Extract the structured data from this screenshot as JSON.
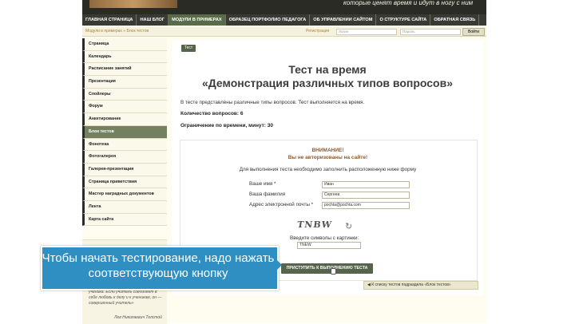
{
  "header": {
    "tagline": "которые ценят время и идут в ногу с ним"
  },
  "nav": {
    "items": [
      "ГЛАВНАЯ СТРАНИЦА",
      "НАШ БЛОГ",
      "МОДУЛИ В ПРИМЕРАХ",
      "ОБРАЗЕЦ ПОРТФОЛИО ПЕДАГОГА",
      "ОБ УПРАВЛЕНИИ САЙТОМ",
      "О СТРУКТУРЕ САЙТА",
      "ОБРАТНАЯ СВЯЗЬ"
    ],
    "active_index": 2
  },
  "subbar": {
    "breadcrumb": "Модули в примерах » Блок тестов",
    "register_link": "Регистрация",
    "login_placeholder": "Логин",
    "password_placeholder": "Пароль",
    "login_button": "Войти"
  },
  "sidebar": {
    "items": [
      "Страница",
      "Календарь",
      "Расписание занятий",
      "Презентация",
      "Спойлеры",
      "Форум",
      "Анкетирование",
      "Блок тестов",
      "Фонотека",
      "Фотогалерея",
      "Галерея-презентация",
      "Страница приветствия",
      "Мастер наградных документов",
      "Лента",
      "Карта сайта"
    ],
    "active_index": 7,
    "quote_text": "ученика. Если учитель соединяет в себе любовь к делу и к ученикам, он — совершенный учитель»",
    "quote_author": "Лев Николаевич Толстой"
  },
  "main": {
    "test_button": "Тест",
    "title_line1": "Тест на время",
    "title_line2": "«Демонстрация различных типов вопросов»",
    "description": "В тесте представлены различные типы вопросов. Тест выполняется на время.",
    "question_count": "Количество вопросов: 6",
    "time_limit": "Ограничение по времени, минут: 30",
    "warning_title": "ВНИМАНИЕ!",
    "warning_text": "Вы не авторизованы на сайте!",
    "instructions": "Для выполнения теста необходимо заполнить расположенную ниже форму",
    "form": {
      "name_label": "Ваше имя *",
      "name_value": "Иван",
      "surname_label": "Ваша фамилия",
      "surname_value": "Сергеев",
      "email_label": "Адрес электронной почты *",
      "email_value": "pochta@pochta.com",
      "captcha_image_text": "TNBW",
      "captcha_label": "Введите символы с картинки:",
      "captcha_value": "TNEW"
    },
    "start_button": "ПРИСТУПИТЬ К ВЫПОЛНЕНИЮ ТЕСТА",
    "back_link": "К списку тестов подраздела «Блок тестов»"
  },
  "tooltip": {
    "line1": "Чтобы начать тестирование, надо нажать",
    "line2": "соответствующую кнопку"
  },
  "colors": {
    "nav_bg": "#3a3a34",
    "accent_green": "#55644a",
    "tooltip_blue": "#2f8ec2",
    "warning_brown": "#8b5a2b"
  }
}
